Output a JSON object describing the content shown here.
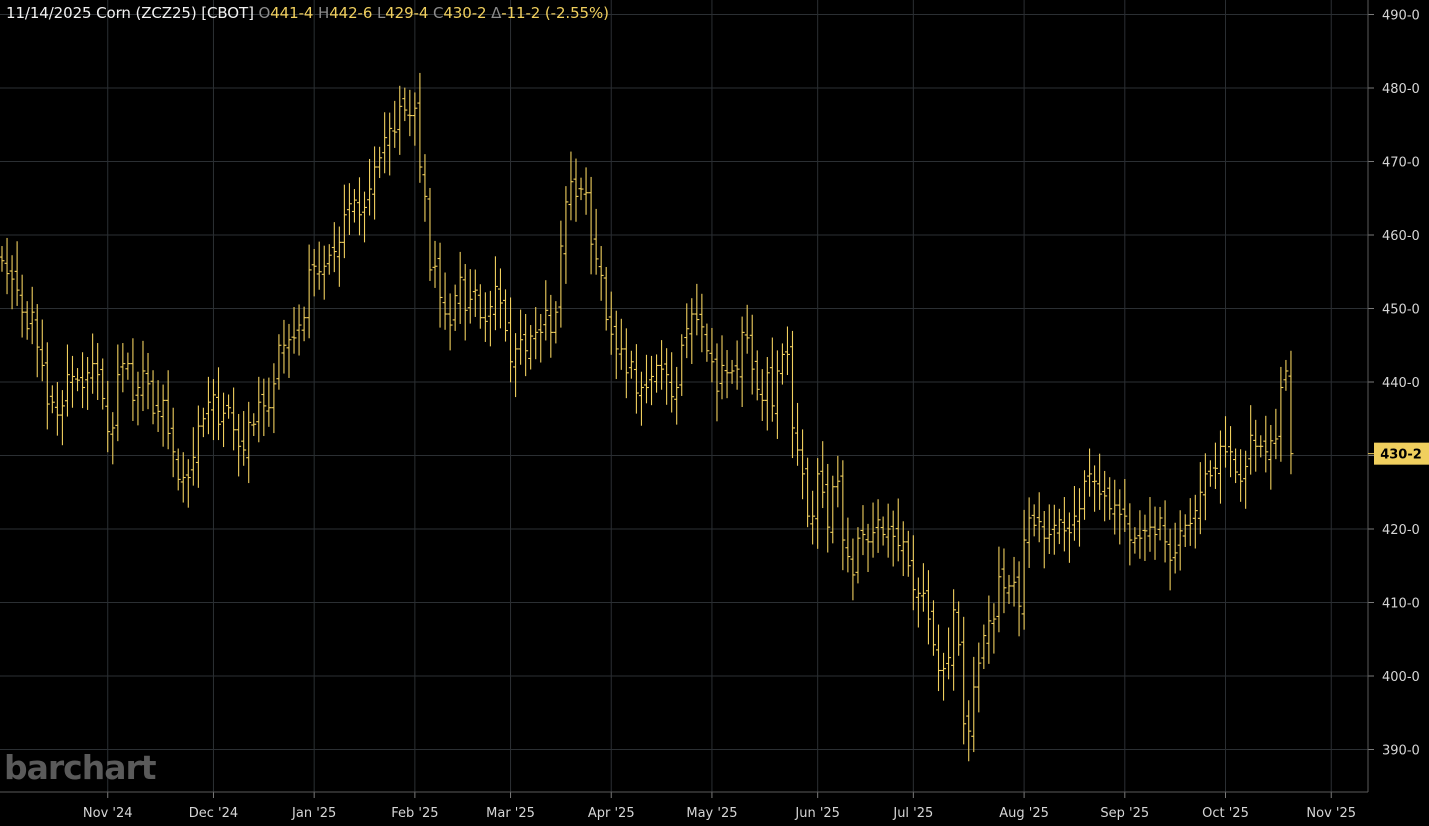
{
  "header": {
    "date": "11/14/2025",
    "symbol": "Corn (ZCZ25) [CBOT]",
    "open_label": "O",
    "open": "441-4",
    "high_label": "H",
    "high": "442-6",
    "low_label": "L",
    "low": "429-4",
    "close_label": "C",
    "close": "430-2",
    "change_label": "Δ",
    "change": "-11-2 (-2.55%)"
  },
  "watermark": "barchart",
  "colors": {
    "background": "#000000",
    "grid": "#2b2f33",
    "bars": "#f0cf5e",
    "axis_text": "#d6d6d6",
    "price_tag": "#f0cf5e"
  },
  "chart_data": {
    "type": "ohlc",
    "y_axis_ticks": [
      "490-0",
      "480-0",
      "470-0",
      "460-0",
      "450-0",
      "440-0",
      "430-0",
      "420-0",
      "410-0",
      "400-0",
      "390-0"
    ],
    "ylim": [
      386,
      492
    ],
    "x_tick_labels": [
      "Nov '24",
      "Dec '24",
      "Jan '25",
      "Feb '25",
      "Mar '25",
      "Apr '25",
      "May '25",
      "Jun '25",
      "Jul '25",
      "Aug '25",
      "Sep '25",
      "Oct '25",
      "Nov '25"
    ],
    "x_tick_index": [
      21,
      42,
      62,
      82,
      101,
      121,
      141,
      162,
      181,
      203,
      223,
      243,
      264
    ],
    "last_price_label": "430-2",
    "last_price": 430.25,
    "closes": [
      456.5,
      454.75,
      454,
      452.5,
      449.5,
      447.25,
      449.5,
      444.75,
      442.25,
      437,
      437.25,
      435.5,
      436.75,
      441,
      440.75,
      440.25,
      439.25,
      441.25,
      442.5,
      441,
      437.75,
      433.25,
      433.75,
      441,
      442.5,
      442.5,
      437.5,
      439.25,
      441.5,
      439.75,
      435.75,
      436,
      437.5,
      433,
      430.5,
      426.75,
      427,
      427,
      429.75,
      434,
      435,
      437.25,
      438.25,
      434.25,
      435.75,
      436.5,
      433.5,
      431.25,
      430.75,
      434.5,
      434.25,
      437.25,
      436.75,
      436.5,
      439.75,
      445,
      445,
      445.75,
      446,
      447.75,
      448.75,
      455.25,
      455.75,
      455,
      455.75,
      457.25,
      457.75,
      459,
      462.75,
      464.25,
      464.75,
      462.75,
      463.75,
      466.25,
      469.25,
      470.5,
      473.25,
      474.5,
      474,
      477.5,
      477,
      476.25,
      477.25,
      469.25,
      465.25,
      455.25,
      455.75,
      451.5,
      449.25,
      447.75,
      451.75,
      454.25,
      449.75,
      451.25,
      452.5,
      448.75,
      448.25,
      450.25,
      453,
      450.75,
      447,
      442.75,
      444.5,
      445.75,
      444.25,
      446.25,
      446.75,
      446.75,
      449.75,
      446.75,
      449.5,
      458.5,
      464.5,
      467.25,
      465.25,
      466.25,
      465.75,
      458.75,
      456.75,
      454.5,
      448.5,
      446.5,
      444.5,
      444.5,
      441.25,
      442.75,
      438.5,
      439.25,
      439.25,
      440.75,
      442.25,
      441.75,
      441,
      438,
      439.25,
      445,
      447.25,
      449.25,
      448.5,
      447.5,
      444.25,
      442.75,
      438.75,
      442.25,
      441.25,
      441.5,
      441.75,
      446.75,
      446,
      441.75,
      439,
      437.5,
      441.25,
      436.75,
      441.5,
      443.75,
      443.75,
      433.75,
      430.75,
      427.5,
      421.75,
      421.75,
      427.5,
      425,
      420.25,
      425.75,
      426.5,
      418.5,
      416.25,
      413.75,
      418.75,
      419.25,
      418.25,
      419.5,
      421.25,
      419.25,
      420,
      419,
      417.75,
      418.25,
      415,
      411.75,
      411.25,
      411.25,
      407.75,
      404.25,
      400.75,
      401,
      402.5,
      409,
      404.25,
      393.5,
      392.5,
      398.5,
      401.75,
      405.5,
      407.5,
      407.75,
      413.5,
      412,
      412.25,
      412.75,
      409.5,
      418.5,
      421.5,
      420.5,
      421,
      418.75,
      419.25,
      420.5,
      421.25,
      419.75,
      419.5,
      421.75,
      422.75,
      426.5,
      427.5,
      426.5,
      424.75,
      424.5,
      422.75,
      423.25,
      422,
      421.75,
      418.5,
      418.75,
      418.75,
      419.75,
      420.25,
      419.25,
      421.5,
      418.25,
      415.75,
      416.75,
      419.75,
      420.5,
      420.75,
      422.5,
      425,
      427.5,
      427.25,
      428.25,
      431.25,
      430.5,
      430.5,
      427.75,
      426.5,
      428.5,
      432.75,
      431.25,
      431.25,
      430.5,
      432,
      432.25,
      439.25,
      441.5,
      430.25
    ]
  }
}
